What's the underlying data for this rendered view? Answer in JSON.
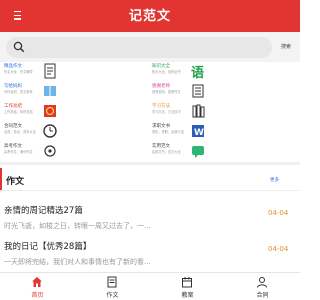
{
  "header": {
    "title": "记范文"
  },
  "search": {
    "placeholder": "",
    "button_label": "搜索"
  },
  "categories": [
    {
      "title": "精品作文",
      "desc": "作文大全，作文辅导",
      "title_color": "#2a6fd6"
    },
    {
      "title": "知识大全",
      "desc": "知识大全，百科全书",
      "title_color": "#1f9e4a"
    },
    {
      "title": "写给妈妈",
      "desc": "写作素材，范文参考",
      "title_color": "#2a6fd6"
    },
    {
      "title": "感谢老师",
      "desc": "感恩老师，感恩作文",
      "title_color": "#d23a9a"
    },
    {
      "title": "工作总结",
      "desc": "工作总结，年终总结",
      "title_color": "#e23532"
    },
    {
      "title": "学习方法",
      "desc": "学习方法，方法技巧",
      "title_color": "#e0902a"
    },
    {
      "title": "合同范文",
      "desc": "合同，协议，范本大全",
      "title_color": "#444444"
    },
    {
      "title": "求职文书",
      "desc": "简历，求职，自我介绍",
      "title_color": "#444444"
    },
    {
      "title": "高考作文",
      "desc": "高考作文，满分作文",
      "title_color": "#444444"
    },
    {
      "title": "实用范文",
      "desc": "实用文书，范文大全",
      "title_color": "#444444"
    }
  ],
  "section": {
    "title": "作文",
    "more_label": "更多"
  },
  "articles": [
    {
      "title": "亲情的周记精选27篇",
      "date": "04-04",
      "excerpt": "时光飞逝，如梭之日，转眼一周又过去了，一..."
    },
    {
      "title": "我的日记【优秀28篇】",
      "date": "04-04",
      "excerpt": "一天即将完结，我们对人和事情也有了新的看..."
    }
  ],
  "tabs": [
    {
      "label": "首页",
      "icon": "home-icon",
      "active": true
    },
    {
      "label": "作文",
      "icon": "document-icon",
      "active": false
    },
    {
      "label": "教案",
      "icon": "calendar-icon",
      "active": false
    },
    {
      "label": "合同",
      "icon": "user-icon",
      "active": false
    }
  ],
  "colors": {
    "brand": "#e23532",
    "date": "#e0902a",
    "link": "#2a6fd6"
  }
}
